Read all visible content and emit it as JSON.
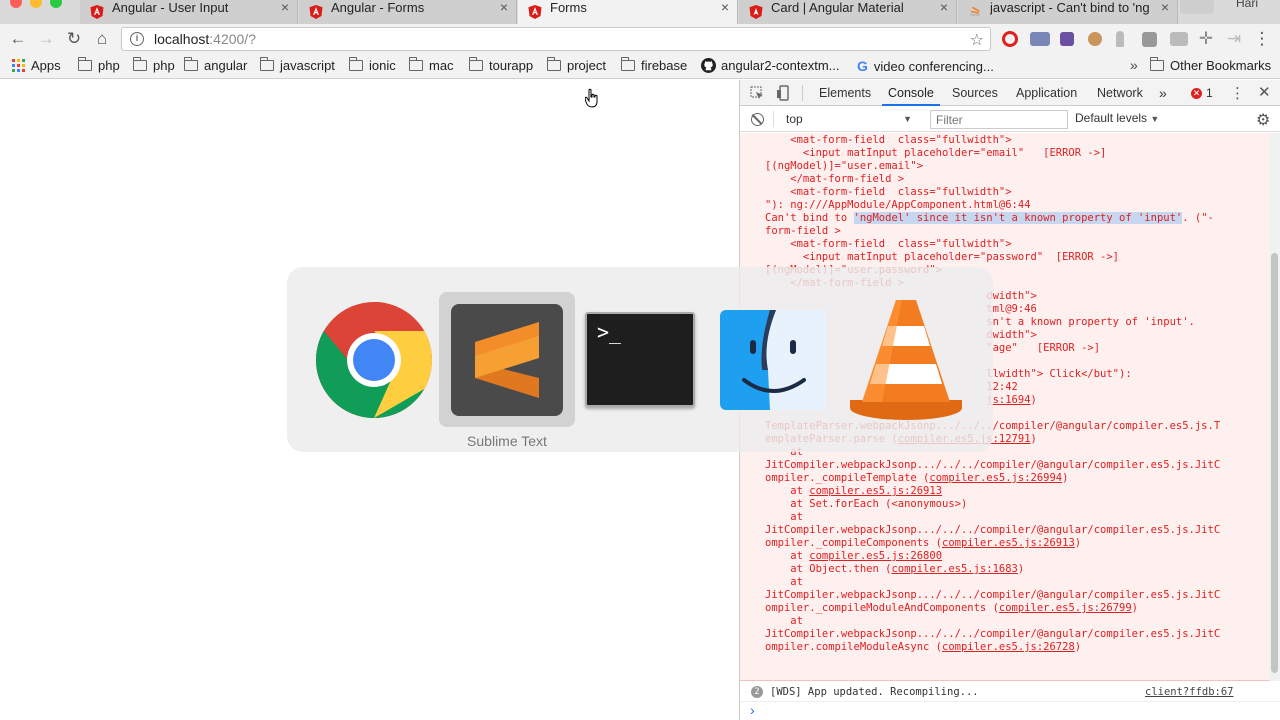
{
  "tabs": [
    {
      "title": "Angular - User Input",
      "close": "×"
    },
    {
      "title": "Angular - Forms",
      "close": "×"
    },
    {
      "title": "Forms",
      "close": "×"
    },
    {
      "title": "Card | Angular Material",
      "close": "×"
    },
    {
      "title": "javascript - Can't bind to 'ng",
      "close": "×"
    }
  ],
  "profile_name": "Hari",
  "address": {
    "host": "localhost",
    "path": ":4200/?"
  },
  "bookmarks": [
    {
      "label": "Apps"
    },
    {
      "label": "php"
    },
    {
      "label": "php"
    },
    {
      "label": "angular"
    },
    {
      "label": "javascript"
    },
    {
      "label": "ionic"
    },
    {
      "label": "mac"
    },
    {
      "label": "tourapp"
    },
    {
      "label": "project"
    },
    {
      "label": "firebase"
    },
    {
      "label": "angular2-contextm..."
    },
    {
      "label": "video conferencing..."
    }
  ],
  "bookmarks_overflow": "»",
  "other_bookmarks": "Other Bookmarks",
  "devtools": {
    "tabs": [
      "Elements",
      "Console",
      "Sources",
      "Application",
      "Network"
    ],
    "more": "»",
    "error_count": "1",
    "context": "top",
    "filter_placeholder": "Filter",
    "levels": "Default levels",
    "console_lines": [
      "    <mat-form-field  class=\"fullwidth\">",
      "      <input matInput placeholder=\"email\"   [ERROR ->]",
      "[(ngModel)]=\"user.email\">",
      "    </mat-form-field >",
      "    <mat-form-field  class=\"fullwidth\">",
      "\"): ng:///AppModule/AppComponent.html@6:44",
      "Can't bind to 'ngModel' since it isn't a known property of 'input'. (\"-",
      "form-field >",
      "    <mat-form-field  class=\"fullwidth\">",
      "      <input matInput placeholder=\"password\"  [ERROR ->]",
      "[(ngModel)]=\"user.password\">",
      "    </mat-form-field >",
      "                                   dwidth\">",
      "                                   tml@9:46",
      "                                   sn't a known property of 'input'.",
      "                                   dwidth\">",
      "                                   \"age\"   [ERROR ->]",
      "",
      "                                   llwidth\"> Click</but\"):",
      "                                   12:42",
      "                                   js:1694)",
      "",
      "TemplateParser.webpackJsonp.../../../compiler/@angular/compiler.es5.js.T",
      "emplateParser.parse (compiler.es5.js:12791)",
      "    at",
      "JitCompiler.webpackJsonp.../../../compiler/@angular/compiler.es5.js.JitC",
      "ompiler._compileTemplate (compiler.es5.js:26994)",
      "    at compiler.es5.js:26913",
      "    at Set.forEach (<anonymous>)",
      "    at",
      "JitCompiler.webpackJsonp.../../../compiler/@angular/compiler.es5.js.JitC",
      "ompiler._compileComponents (compiler.es5.js:26913)",
      "    at compiler.es5.js:26800",
      "    at Object.then (compiler.es5.js:1683)",
      "    at",
      "JitCompiler.webpackJsonp.../../../compiler/@angular/compiler.es5.js.JitC",
      "ompiler._compileModuleAndComponents (compiler.es5.js:26799)",
      "    at",
      "JitCompiler.webpackJsonp.../../../compiler/@angular/compiler.es5.js.JitC",
      "ompiler.compileModuleAsync (compiler.es5.js:26728)"
    ],
    "highlight_text": "'ngModel' since it isn't a known property of 'input'",
    "wds_count": "2",
    "wds_message": "[WDS] App updated. Recompiling...",
    "wds_source": "client?ffdb:67",
    "prompt_symbol": "›"
  },
  "app_switcher": {
    "apps": [
      "chrome-icon",
      "sublime-text-icon",
      "terminal-icon",
      "finder-icon",
      "vlc-icon"
    ],
    "selected_label": "Sublime Text",
    "terminal_prompt": ">_"
  },
  "colors": {
    "error_text": "#e02020",
    "console_error_bg": "#fff0f0",
    "active_tab_indicator": "#1a73e8",
    "sublime_orange": "#f28d2a",
    "vlc_orange": "#f47c20"
  }
}
